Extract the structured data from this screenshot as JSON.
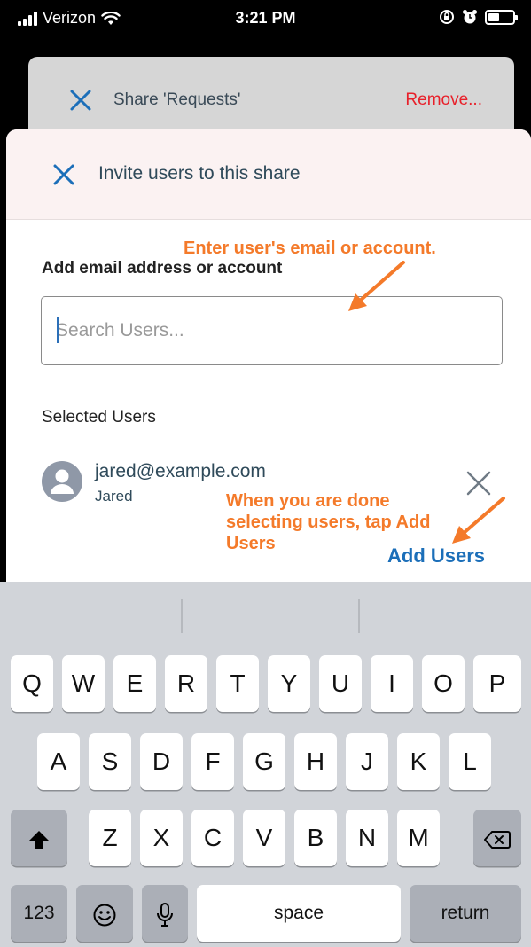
{
  "status_bar": {
    "carrier": "Verizon",
    "time": "3:21 PM"
  },
  "back_sheet": {
    "title": "Share 'Requests'",
    "remove_label": "Remove..."
  },
  "invite": {
    "title": "Invite users to this share",
    "field_label": "Add email address or account",
    "search_placeholder": "Search Users...",
    "search_value": "",
    "selected_label": "Selected Users",
    "selected_users": [
      {
        "email": "jared@example.com",
        "name": "Jared"
      }
    ],
    "add_users_label": "Add Users"
  },
  "annotations": {
    "email_hint": "Enter user's email or account.",
    "done_hint": "When you are done selecting users, tap Add Users"
  },
  "keyboard": {
    "row1": [
      "Q",
      "W",
      "E",
      "R",
      "T",
      "Y",
      "U",
      "I",
      "O",
      "P"
    ],
    "row2": [
      "A",
      "S",
      "D",
      "F",
      "G",
      "H",
      "J",
      "K",
      "L"
    ],
    "row3": [
      "Z",
      "X",
      "C",
      "V",
      "B",
      "N",
      "M"
    ],
    "numbers_label": "123",
    "space_label": "space",
    "return_label": "return"
  },
  "colors": {
    "accent": "#1c6fb9",
    "destructive": "#e8202a",
    "annotation": "#f47a2a"
  }
}
